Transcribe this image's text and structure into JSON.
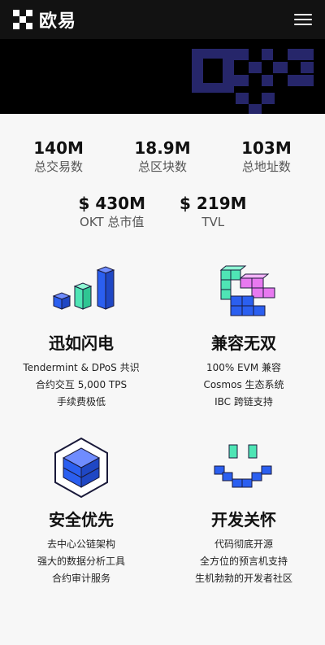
{
  "header": {
    "brand": "欧易",
    "logo_icon": "okx-logo-icon",
    "menu_icon": "hamburger-menu-icon"
  },
  "stats": [
    {
      "value": "140M",
      "label": "总交易数"
    },
    {
      "value": "18.9M",
      "label": "总区块数"
    },
    {
      "value": "103M",
      "label": "总地址数"
    },
    {
      "value": "$ 430M",
      "label": "OKT 总市值"
    },
    {
      "value": "$ 219M",
      "label": "TVL"
    }
  ],
  "features": [
    {
      "title": "迅如闪电",
      "lines": [
        "Tendermint & DPoS 共识",
        "合约交互 5,000 TPS",
        "手续费极低"
      ],
      "icon": "bar-chart-cubes-icon"
    },
    {
      "title": "兼容无双",
      "lines": [
        "100% EVM 兼容",
        "Cosmos 生态系统",
        "IBC 跨链支持"
      ],
      "icon": "stacked-blocks-icon"
    },
    {
      "title": "安全优先",
      "lines": [
        "去中心公链架构",
        "强大的数据分析工具",
        "合约审计服务"
      ],
      "icon": "hexagon-cube-icon"
    },
    {
      "title": "开发关怀",
      "lines": [
        "代码彻底开源",
        "全方位的预言机支持",
        "生机勃勃的开发者社区"
      ],
      "icon": "smiley-blocks-icon"
    }
  ],
  "colors": {
    "topbar": "#121212",
    "hero": "#000000",
    "hero_blocks": "#2a2a6e",
    "blue": "#2b5ff0",
    "mint": "#4fe5b5",
    "pink": "#e879f0"
  }
}
